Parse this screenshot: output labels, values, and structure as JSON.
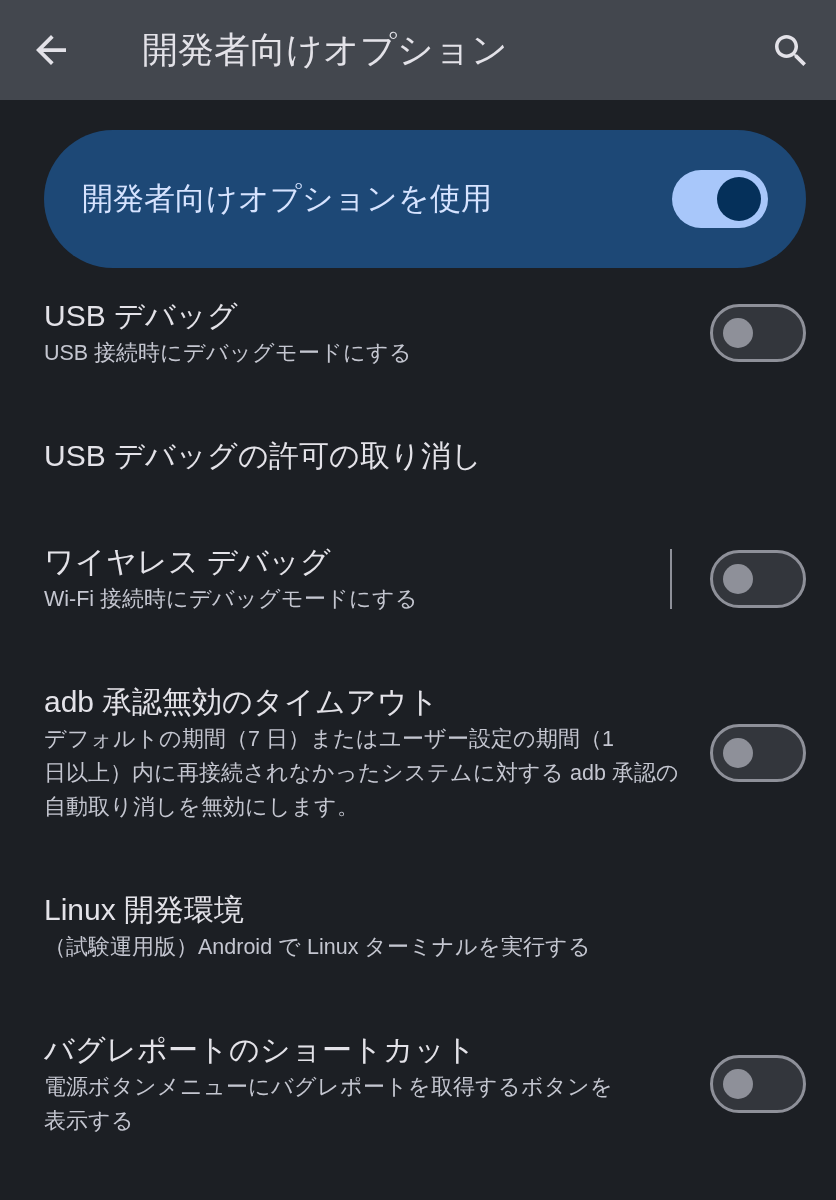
{
  "app_bar": {
    "title": "開発者向けオプション"
  },
  "main_switch": {
    "label": "開発者向けオプションを使用",
    "on": true
  },
  "items": [
    {
      "kind": "switch",
      "title": "USB デバッグ",
      "summary": "USB 接続時にデバッグモードにする",
      "on": false
    },
    {
      "kind": "link",
      "title": "USB デバッグの許可の取り消し"
    },
    {
      "kind": "split_switch",
      "title": "ワイヤレス デバッグ",
      "summary": "Wi-Fi 接続時にデバッグモードにする",
      "on": false
    },
    {
      "kind": "switch",
      "title": "adb 承認無効のタイムアウト",
      "summary": "デフォルトの期間（7 日）またはユーザー設定の期間（1 日以上）内に再接続されなかったシステムに対する adb 承認の自動取り消しを無効にします。",
      "on": false
    },
    {
      "kind": "link",
      "title": "Linux 開発環境",
      "summary": "（試験運用版）Android で Linux ターミナルを実行する"
    },
    {
      "kind": "switch",
      "title": "バグレポートのショートカット",
      "summary": "電源ボタンメニューにバグレポートを取得するボタンを表示する",
      "on": false
    }
  ]
}
